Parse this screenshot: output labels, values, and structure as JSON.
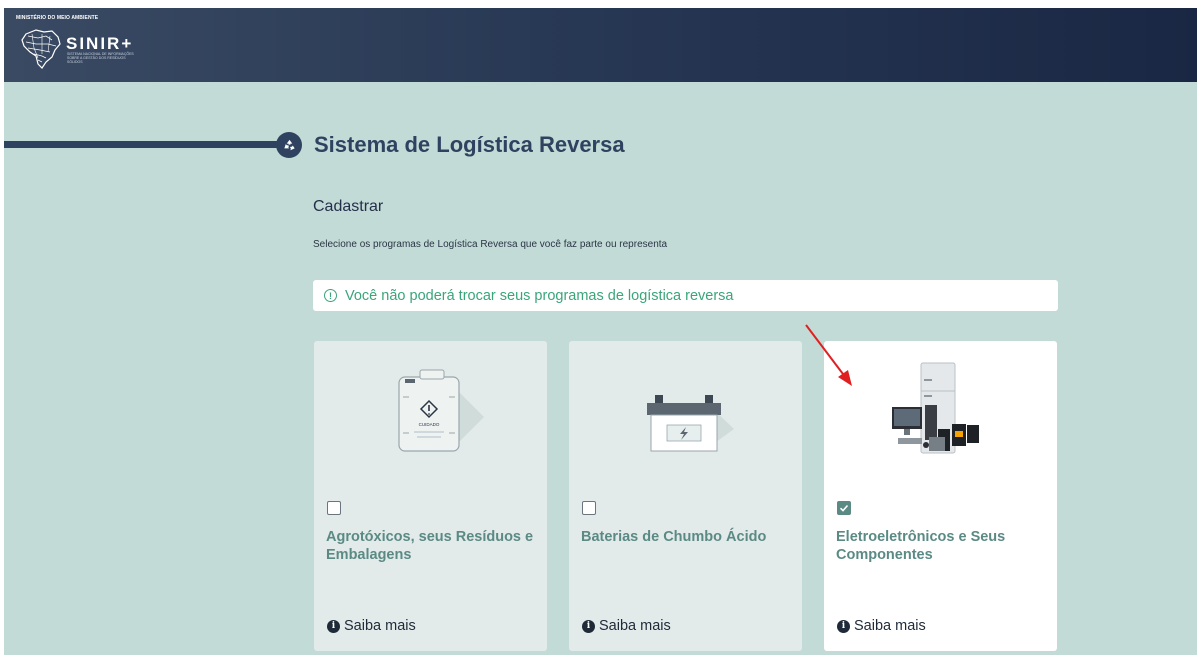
{
  "header": {
    "ministry": "MINISTÉRIO DO MEIO AMBIENTE",
    "brand": "SINIR+",
    "brand_subtitle": "SISTEMA NACIONAL DE INFORMAÇÕES SOBRE A GESTÃO DOS RESÍDUOS SÓLIDOS"
  },
  "page": {
    "title": "Sistema de Logística Reversa",
    "title_icon": "recycle-icon",
    "section_title": "Cadastrar",
    "section_desc": "Selecione os programas de Logística Reversa que você faz parte ou representa",
    "alert": "Você não poderá trocar seus programas de logística reversa",
    "alert_icon": "info-circle-icon"
  },
  "cards": [
    {
      "label": "Agrotóxicos, seus Resíduos e Embalagens",
      "image": "pesticide-container-icon",
      "image_text": "CUIDADO",
      "checked": false,
      "link": "Saiba mais"
    },
    {
      "label": "Baterias de Chumbo Ácido",
      "image": "lead-acid-battery-icon",
      "checked": false,
      "link": "Saiba mais"
    },
    {
      "label": "Eletroeletrônicos e Seus Componentes",
      "image": "electronics-appliances-icon",
      "checked": true,
      "link": "Saiba mais"
    }
  ],
  "colors": {
    "header_bg": "#283955",
    "page_bg": "#c3dbd7",
    "accent": "#2f4360",
    "alert_text": "#3aa57a",
    "card_label": "#5b8a85",
    "arrow": "#e02020"
  }
}
